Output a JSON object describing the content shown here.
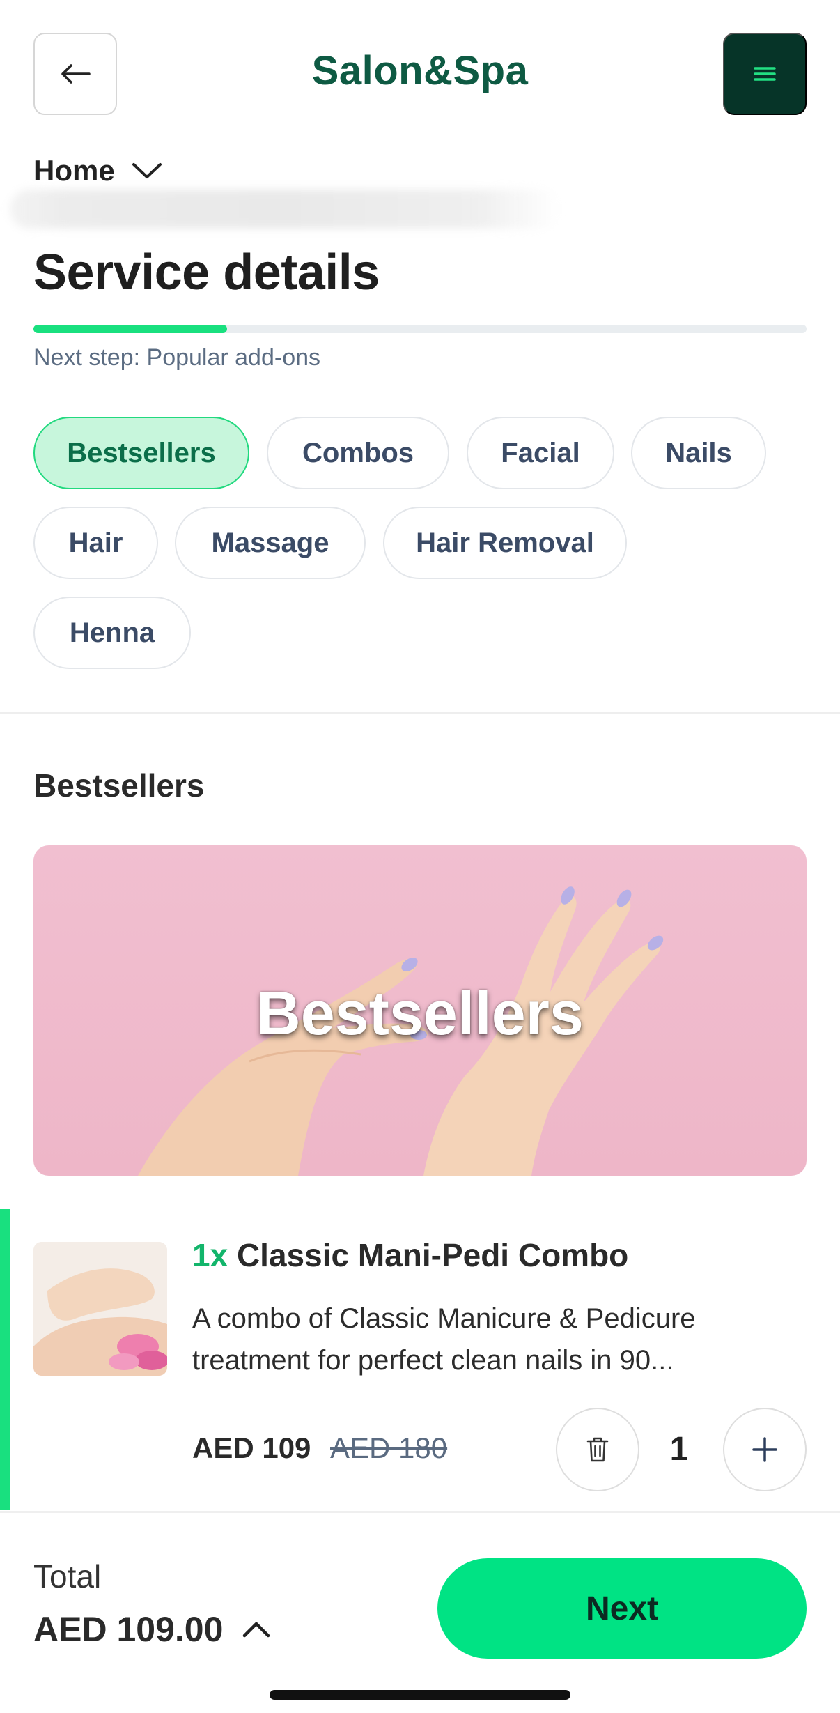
{
  "header": {
    "brand": "Salon&Spa",
    "back_icon": "arrow-left-icon",
    "menu_icon": "hamburger-menu-icon",
    "colors": {
      "brand": "#0e5a43",
      "menu_bg": "#063428",
      "accent": "#00e384"
    }
  },
  "location": {
    "label": "Home"
  },
  "page": {
    "title": "Service details",
    "progress": 0.25,
    "next_step": "Next step: Popular add-ons"
  },
  "categories": [
    {
      "label": "Bestsellers",
      "active": true
    },
    {
      "label": "Combos",
      "active": false
    },
    {
      "label": "Facial",
      "active": false
    },
    {
      "label": "Nails",
      "active": false
    },
    {
      "label": "Hair",
      "active": false
    },
    {
      "label": "Massage",
      "active": false
    },
    {
      "label": "Hair Removal",
      "active": false
    },
    {
      "label": "Henna",
      "active": false
    }
  ],
  "section": {
    "title": "Bestsellers",
    "banner_text": "Bestsellers"
  },
  "service": {
    "qty_prefix": "1x",
    "name": "Classic Mani-Pedi Combo",
    "description_line1": "A combo of Classic Manicure & Pedicure",
    "description_line2": "treatment for perfect clean nails in 90...",
    "price": "AED 109",
    "old_price": "AED 180",
    "quantity": "1"
  },
  "footer": {
    "total_label": "Total",
    "total_value": "AED 109.00",
    "next_label": "Next"
  }
}
